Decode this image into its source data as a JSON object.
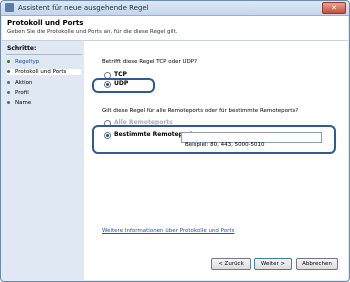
{
  "window": {
    "title": "Assistent für neue ausgehende Regel",
    "close_glyph": "✕"
  },
  "header": {
    "title": "Protokoll und Ports",
    "subtitle": "Geben Sie die Protokolle und Ports an, für die diese Regel gilt."
  },
  "sidebar": {
    "heading": "Schritte:",
    "items": [
      {
        "label": "Regeltyp",
        "state": "done"
      },
      {
        "label": "Protokoll und Ports",
        "state": "current"
      },
      {
        "label": "Aktion",
        "state": "todo"
      },
      {
        "label": "Profil",
        "state": "todo"
      },
      {
        "label": "Name",
        "state": "todo"
      }
    ]
  },
  "protocol": {
    "question": "Betrifft diese Regel TCP oder UDP?",
    "options": [
      {
        "label": "TCP",
        "selected": false
      },
      {
        "label": "UDP",
        "selected": true
      }
    ]
  },
  "ports": {
    "question": "Gilt diese Regel für alle Remoteports oder für bestimmte Remoteports?",
    "options": [
      {
        "label": "Alle Remoteports",
        "selected": false
      },
      {
        "label": "Bestimmte Remoteports:",
        "selected": true
      }
    ],
    "input_value": "",
    "example": "Beispiel: 80, 443, 5000-5010"
  },
  "more_info_link": "Weitere Informationen über Protokolle und Ports",
  "buttons": {
    "back": "< Zurück",
    "next": "Weiter >",
    "cancel": "Abbrechen"
  }
}
